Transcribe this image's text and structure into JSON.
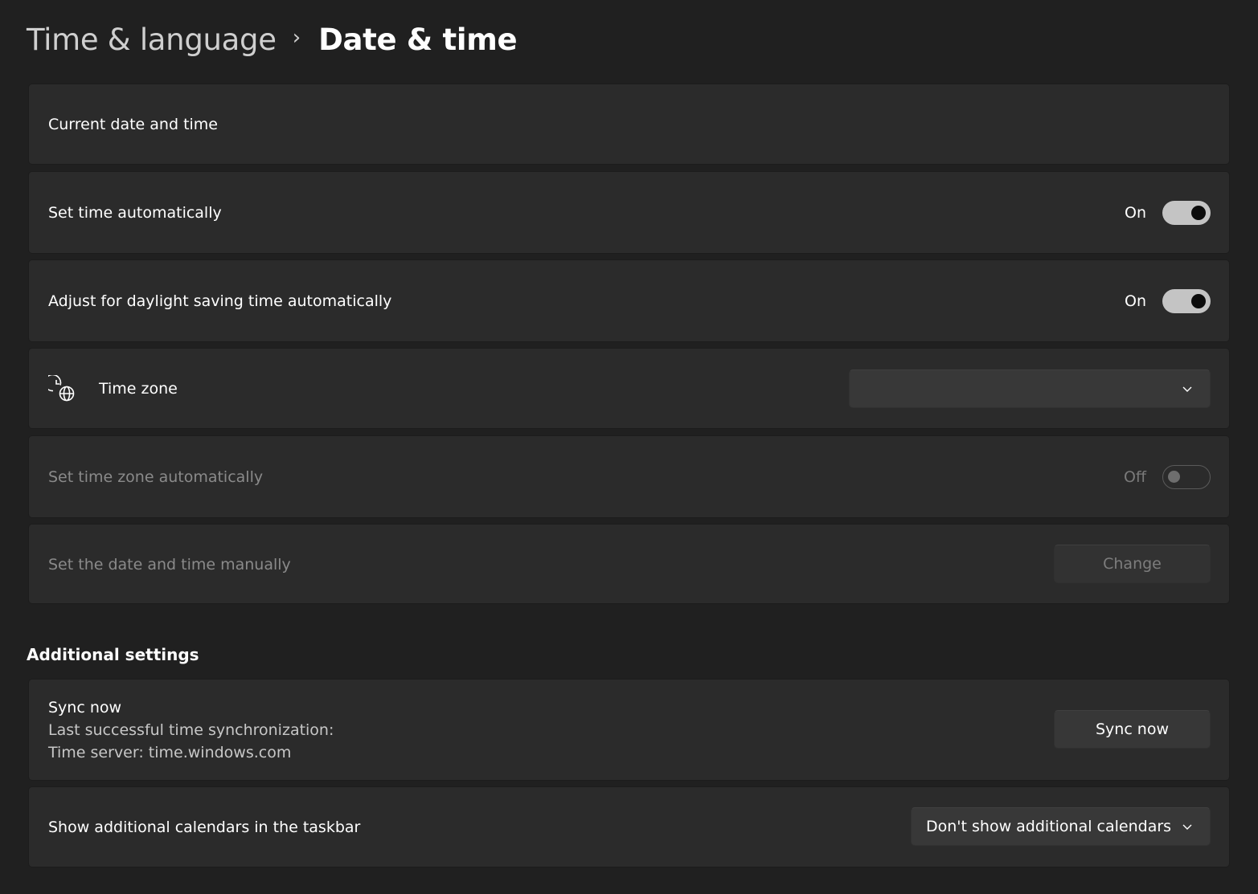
{
  "breadcrumb": {
    "parent": "Time & language",
    "separator": "›",
    "current": "Date & time"
  },
  "settings": {
    "current_date_time": {
      "label": "Current date and time"
    },
    "set_time_auto": {
      "label": "Set time automatically",
      "state": "On",
      "enabled": true
    },
    "daylight_saving": {
      "label": "Adjust for daylight saving time automatically",
      "state": "On",
      "enabled": true
    },
    "time_zone": {
      "label": "Time zone",
      "value": "",
      "icon": "clock-globe-icon"
    },
    "set_time_zone_auto": {
      "label": "Set time zone automatically",
      "state": "Off",
      "enabled": false
    },
    "set_manually": {
      "label": "Set the date and time manually",
      "button": "Change",
      "enabled": false
    }
  },
  "additional": {
    "title": "Additional settings",
    "sync": {
      "label": "Sync now",
      "last_sync": "Last successful time synchronization:",
      "server": "Time server: time.windows.com",
      "button": "Sync now"
    },
    "calendars": {
      "label": "Show additional calendars in the taskbar",
      "value": "Don't show additional calendars"
    }
  },
  "colors": {
    "background": "#202020",
    "card": "#2b2b2b",
    "toggle_on": "#c4c4c4",
    "text": "#ffffff",
    "text_disabled": "#8a8a8a"
  }
}
